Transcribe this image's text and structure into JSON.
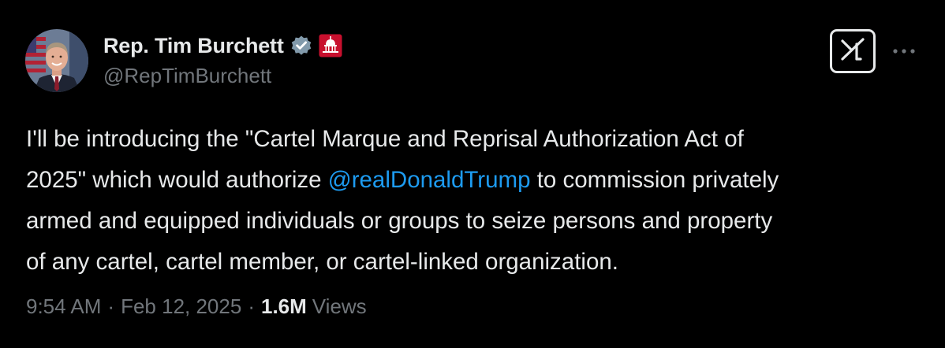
{
  "author": {
    "display_name": "Rep. Tim Burchett",
    "handle": "@RepTimBurchett",
    "verified_icon": "verified-badge-icon",
    "affiliation_icon": "capitol-building-icon"
  },
  "tweet": {
    "line1": "I'll be introducing the \"Cartel Marque and Reprisal Authorization Act of",
    "line2_before": "2025\" which would authorize ",
    "mention": "@realDonaldTrump",
    "line2_after": " to commission privately",
    "line3": "armed and equipped individuals or groups to seize persons and property",
    "line4": "of any cartel, cartel member, or cartel-linked organization."
  },
  "meta": {
    "time": "9:54 AM",
    "separator": "·",
    "date": "Feb 12, 2025",
    "views_count": "1.6M",
    "views_label": "Views"
  },
  "actions": {
    "grok_icon": "grok-icon",
    "more_icon": "more-horizontal-icon"
  },
  "colors": {
    "background": "#000000",
    "text_primary": "#e7e9ea",
    "text_secondary": "#71767b",
    "mention": "#1d9bf0",
    "verified_badge": "#829aab",
    "affiliation_badge": "#c8102e"
  }
}
